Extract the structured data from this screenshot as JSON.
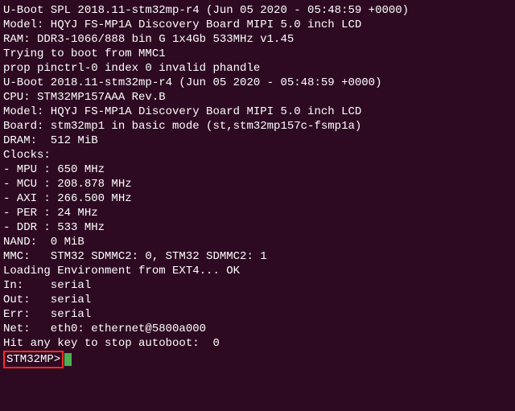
{
  "terminal": {
    "lines": {
      "l0": "U-Boot SPL 2018.11-stm32mp-r4 (Jun 05 2020 - 05:48:59 +0000)",
      "l1": "Model: HQYJ FS-MP1A Discovery Board MIPI 5.0 inch LCD",
      "l2": "RAM: DDR3-1066/888 bin G 1x4Gb 533MHz v1.45",
      "l3": "Trying to boot from MMC1",
      "l4": "prop pinctrl-0 index 0 invalid phandle",
      "l5": "",
      "l6": "",
      "l7": "U-Boot 2018.11-stm32mp-r4 (Jun 05 2020 - 05:48:59 +0000)",
      "l8": "",
      "l9": "CPU: STM32MP157AAA Rev.B",
      "l10": "Model: HQYJ FS-MP1A Discovery Board MIPI 5.0 inch LCD",
      "l11": "Board: stm32mp1 in basic mode (st,stm32mp157c-fsmp1a)",
      "l12": "DRAM:  512 MiB",
      "l13": "Clocks:",
      "l14": "- MPU : 650 MHz",
      "l15": "- MCU : 208.878 MHz",
      "l16": "- AXI : 266.500 MHz",
      "l17": "- PER : 24 MHz",
      "l18": "- DDR : 533 MHz",
      "l19": "NAND:  0 MiB",
      "l20": "MMC:   STM32 SDMMC2: 0, STM32 SDMMC2: 1",
      "l21": "Loading Environment from EXT4... OK",
      "l22": "In:    serial",
      "l23": "Out:   serial",
      "l24": "Err:   serial",
      "l25": "Net:   eth0: ethernet@5800a000",
      "l26": "Hit any key to stop autoboot:  0 "
    },
    "prompt": "STM32MP>"
  }
}
